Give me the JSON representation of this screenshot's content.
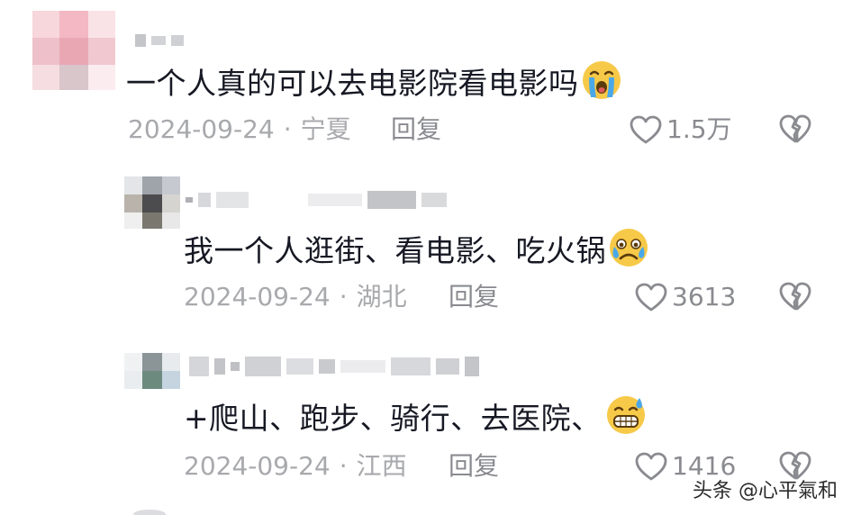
{
  "comments": [
    {
      "text": "一个人真的可以去电影院看电影吗",
      "emoji": "loudly-crying-face",
      "date": "2024-09-24",
      "separator": "·",
      "location": "宁夏",
      "reply_label": "回复",
      "likes": "1.5万"
    },
    {
      "text": "我一个人逛街、看电影、吃火锅",
      "emoji": "sad-face-with-tear",
      "date": "2024-09-24",
      "separator": "·",
      "location": "湖北",
      "reply_label": "回复",
      "likes": "3613"
    },
    {
      "text": "+爬山、跑步、骑行、去医院、",
      "emoji": "grinning-face-with-sweat",
      "date": "2024-09-24",
      "separator": "·",
      "location": "江西",
      "reply_label": "回复",
      "likes": "1416"
    }
  ],
  "watermark": "头条 @心平氣和",
  "colors": {
    "text": "#161823",
    "meta": "#a8a9ad",
    "action": "#8a8b90",
    "emoji_yellow": "#f7c948",
    "emoji_blue": "#4aa8e8"
  }
}
